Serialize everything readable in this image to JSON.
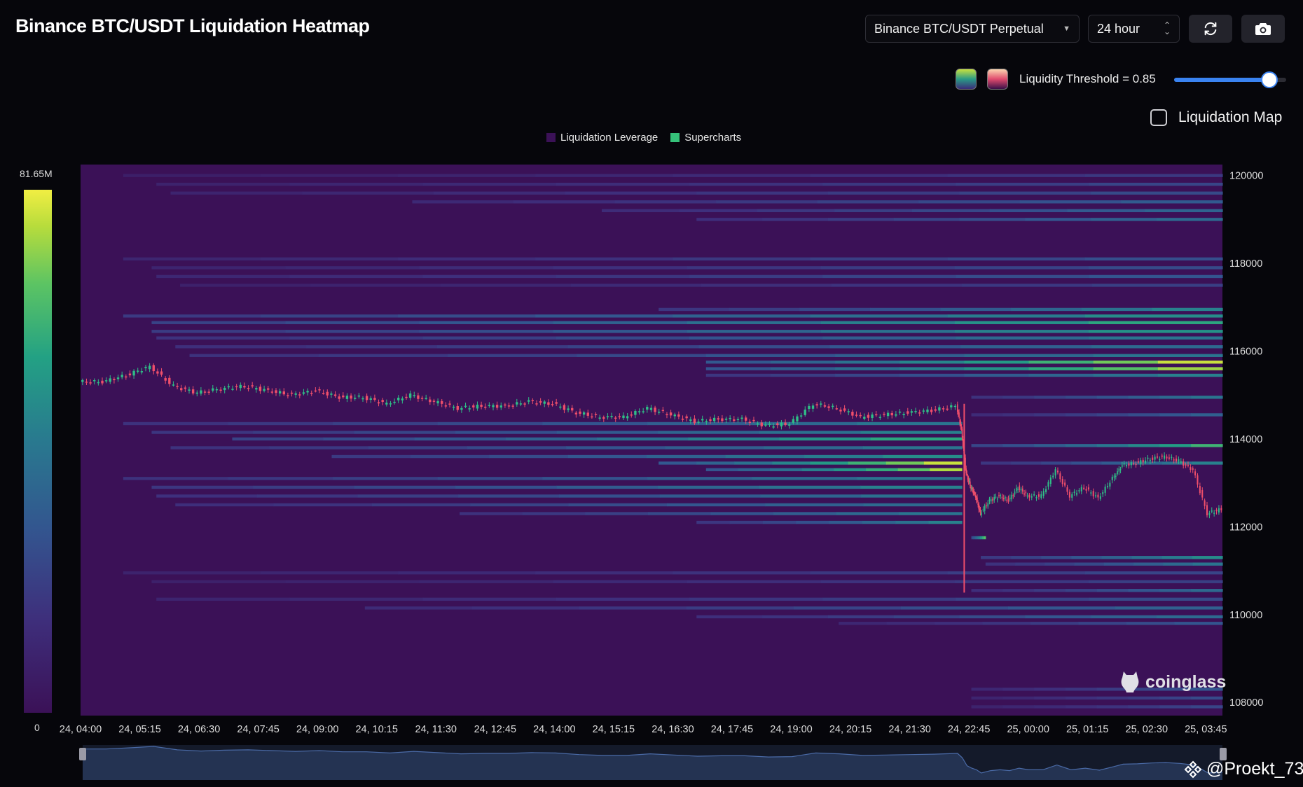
{
  "header": {
    "title": "Binance BTC/USDT Liquidation Heatmap",
    "pair_select": "Binance BTC/USDT Perpetual",
    "range_select": "24 hour",
    "refresh_icon": "refresh-icon",
    "camera_icon": "camera-icon"
  },
  "controls": {
    "threshold_label": "Liquidity Threshold = 0.85",
    "threshold_value": 0.85,
    "liquidation_map_label": "Liquidation Map",
    "liquidation_map_checked": false,
    "palette_swatches": [
      "viridis-palette",
      "magma-palette"
    ]
  },
  "colors": {
    "background": "#06060b",
    "heatmap_base": "#3b1157",
    "accent": "#3a83f1",
    "candle_up": "#2fbf87",
    "candle_down": "#ef4f6b"
  },
  "chart_data": {
    "type": "heatmap",
    "title": "Binance BTC/USDT Liquidation Heatmap",
    "legend": [
      "Liquidation Leverage",
      "Supercharts"
    ],
    "legend_colors": [
      "#3b1157",
      "#35c27a"
    ],
    "colorbar": {
      "min_label": "0",
      "max_label": "81.65M",
      "min": 0,
      "max": 81650000
    },
    "x_ticks": [
      "24, 04:00",
      "24, 05:15",
      "24, 06:30",
      "24, 07:45",
      "24, 09:00",
      "24, 10:15",
      "24, 11:30",
      "24, 12:45",
      "24, 14:00",
      "24, 15:15",
      "24, 16:30",
      "24, 17:45",
      "24, 19:00",
      "24, 20:15",
      "24, 21:30",
      "24, 22:45",
      "25, 00:00",
      "25, 01:15",
      "25, 02:30",
      "25, 03:45"
    ],
    "y_ticks": [
      "120000",
      "118000",
      "116000",
      "114000",
      "112000",
      "110000",
      "108000"
    ],
    "ylim": [
      107700,
      120250
    ],
    "xlim_hours": [
      0,
      24.1
    ],
    "bands": [
      {
        "price": 120000,
        "start": 0.9,
        "end": 24.1,
        "intensity": 0.22
      },
      {
        "price": 119800,
        "start": 1.6,
        "end": 24.1,
        "intensity": 0.28
      },
      {
        "price": 119600,
        "start": 1.9,
        "end": 24.1,
        "intensity": 0.3
      },
      {
        "price": 119400,
        "start": 7.0,
        "end": 24.1,
        "intensity": 0.38
      },
      {
        "price": 119200,
        "start": 11.0,
        "end": 24.1,
        "intensity": 0.42
      },
      {
        "price": 119000,
        "start": 13.0,
        "end": 24.1,
        "intensity": 0.45
      },
      {
        "price": 118100,
        "start": 0.9,
        "end": 24.1,
        "intensity": 0.32
      },
      {
        "price": 117900,
        "start": 1.5,
        "end": 24.1,
        "intensity": 0.3
      },
      {
        "price": 117700,
        "start": 1.6,
        "end": 24.1,
        "intensity": 0.35
      },
      {
        "price": 117500,
        "start": 2.1,
        "end": 24.1,
        "intensity": 0.25
      },
      {
        "price": 116950,
        "start": 12.2,
        "end": 24.1,
        "intensity": 0.55
      },
      {
        "price": 116800,
        "start": 0.9,
        "end": 24.1,
        "intensity": 0.6
      },
      {
        "price": 116650,
        "start": 1.5,
        "end": 24.1,
        "intensity": 0.7
      },
      {
        "price": 116450,
        "start": 1.5,
        "end": 24.1,
        "intensity": 0.62
      },
      {
        "price": 116300,
        "start": 1.6,
        "end": 24.1,
        "intensity": 0.5
      },
      {
        "price": 116100,
        "start": 2.0,
        "end": 24.1,
        "intensity": 0.45
      },
      {
        "price": 115900,
        "start": 2.3,
        "end": 24.1,
        "intensity": 0.5
      },
      {
        "price": 115750,
        "start": 13.2,
        "end": 24.1,
        "intensity": 0.95
      },
      {
        "price": 115600,
        "start": 13.2,
        "end": 24.1,
        "intensity": 0.9
      },
      {
        "price": 115450,
        "start": 13.2,
        "end": 24.1,
        "intensity": 0.55
      },
      {
        "price": 114950,
        "start": 18.8,
        "end": 24.1,
        "intensity": 0.5
      },
      {
        "price": 114550,
        "start": 18.8,
        "end": 24.1,
        "intensity": 0.4
      },
      {
        "price": 114350,
        "start": 0.9,
        "end": 18.6,
        "intensity": 0.5
      },
      {
        "price": 114150,
        "start": 1.5,
        "end": 18.6,
        "intensity": 0.55
      },
      {
        "price": 114000,
        "start": 3.2,
        "end": 18.6,
        "intensity": 0.7
      },
      {
        "price": 113800,
        "start": 1.9,
        "end": 18.6,
        "intensity": 0.5
      },
      {
        "price": 113850,
        "start": 18.8,
        "end": 24.1,
        "intensity": 0.75
      },
      {
        "price": 113600,
        "start": 5.3,
        "end": 18.6,
        "intensity": 0.6
      },
      {
        "price": 113450,
        "start": 12.2,
        "end": 18.6,
        "intensity": 0.95
      },
      {
        "price": 113300,
        "start": 13.2,
        "end": 18.6,
        "intensity": 0.92
      },
      {
        "price": 113450,
        "start": 19.0,
        "end": 24.1,
        "intensity": 0.55
      },
      {
        "price": 113100,
        "start": 0.9,
        "end": 18.6,
        "intensity": 0.5
      },
      {
        "price": 112900,
        "start": 1.5,
        "end": 18.6,
        "intensity": 0.55
      },
      {
        "price": 112700,
        "start": 1.6,
        "end": 18.6,
        "intensity": 0.48
      },
      {
        "price": 112500,
        "start": 2.0,
        "end": 18.6,
        "intensity": 0.45
      },
      {
        "price": 112300,
        "start": 8.0,
        "end": 18.6,
        "intensity": 0.5
      },
      {
        "price": 112100,
        "start": 13.0,
        "end": 18.6,
        "intensity": 0.55
      },
      {
        "price": 111750,
        "start": 18.8,
        "end": 19.1,
        "intensity": 0.8
      },
      {
        "price": 111300,
        "start": 19.0,
        "end": 24.1,
        "intensity": 0.6
      },
      {
        "price": 111150,
        "start": 19.1,
        "end": 24.1,
        "intensity": 0.5
      },
      {
        "price": 110950,
        "start": 0.9,
        "end": 24.1,
        "intensity": 0.28
      },
      {
        "price": 110750,
        "start": 1.5,
        "end": 24.1,
        "intensity": 0.25
      },
      {
        "price": 110550,
        "start": 18.8,
        "end": 24.1,
        "intensity": 0.45
      },
      {
        "price": 110350,
        "start": 1.6,
        "end": 24.1,
        "intensity": 0.3
      },
      {
        "price": 110150,
        "start": 6.0,
        "end": 24.1,
        "intensity": 0.4
      },
      {
        "price": 109950,
        "start": 13.0,
        "end": 24.1,
        "intensity": 0.45
      },
      {
        "price": 109800,
        "start": 16.0,
        "end": 24.1,
        "intensity": 0.35
      },
      {
        "price": 108300,
        "start": 18.8,
        "end": 24.1,
        "intensity": 0.35
      },
      {
        "price": 108100,
        "start": 18.8,
        "end": 24.1,
        "intensity": 0.3
      },
      {
        "price": 107900,
        "start": 18.8,
        "end": 24.1,
        "intensity": 0.28
      }
    ],
    "price_series": {
      "x_hours": [
        0,
        0.5,
        1,
        1.5,
        2,
        2.5,
        3,
        3.5,
        4,
        4.5,
        5,
        5.5,
        6,
        6.5,
        7,
        7.5,
        8,
        8.5,
        9,
        9.5,
        10,
        10.5,
        11,
        11.5,
        12,
        12.5,
        13,
        13.5,
        14,
        14.5,
        15,
        15.5,
        16,
        16.5,
        17,
        17.5,
        18,
        18.5,
        18.6,
        18.7,
        18.8,
        18.9,
        19,
        19.2,
        19.4,
        19.6,
        19.8,
        20,
        20.3,
        20.6,
        20.9,
        21.2,
        21.5,
        21.8,
        22,
        22.3,
        22.6,
        22.9,
        23.2,
        23.5,
        23.8,
        24.1
      ],
      "close": [
        115300,
        115300,
        115450,
        115650,
        115200,
        115050,
        115150,
        115200,
        115100,
        115000,
        115100,
        114950,
        114950,
        114800,
        115000,
        114850,
        114700,
        114750,
        114750,
        114850,
        114800,
        114600,
        114500,
        114500,
        114700,
        114550,
        114400,
        114450,
        114450,
        114300,
        114350,
        114800,
        114700,
        114500,
        114550,
        114600,
        114650,
        114750,
        114200,
        113200,
        112900,
        112700,
        112300,
        112600,
        112700,
        112600,
        112900,
        112700,
        112700,
        113300,
        112700,
        112900,
        112650,
        113100,
        113400,
        113450,
        113550,
        113600,
        113500,
        113300,
        112300,
        112400
      ],
      "low_spike_at_hours": 18.65,
      "low_spike_value": 110500
    }
  },
  "watermark": {
    "text": "coinglass",
    "icon": "coinglass-logo-icon"
  },
  "credit": {
    "text": "@Proekt_73",
    "icon": "binance-diamond-icon"
  }
}
